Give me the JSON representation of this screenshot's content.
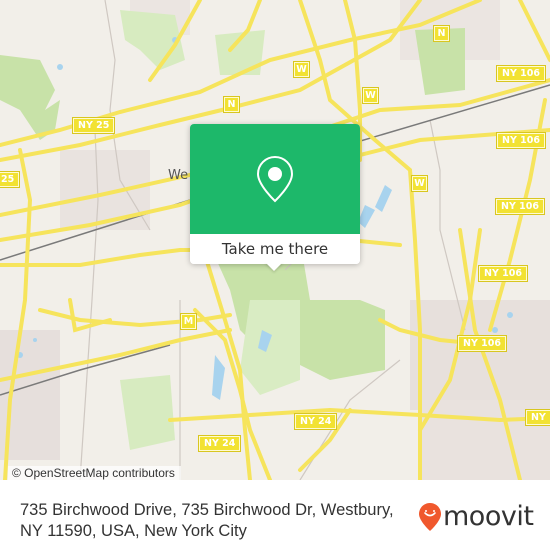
{
  "map": {
    "place_label": "We",
    "road_shields": [
      {
        "label": "NY 25",
        "kind": "wide"
      },
      {
        "label": "25",
        "kind": "wide"
      },
      {
        "label": "N",
        "kind": "square"
      },
      {
        "label": "N",
        "kind": "square"
      },
      {
        "label": "W",
        "kind": "square"
      },
      {
        "label": "W",
        "kind": "square"
      },
      {
        "label": "W",
        "kind": "square"
      },
      {
        "label": "M",
        "kind": "square"
      },
      {
        "label": "NY 106",
        "kind": "wide"
      },
      {
        "label": "NY 106",
        "kind": "wide"
      },
      {
        "label": "NY 106",
        "kind": "wide"
      },
      {
        "label": "NY 106",
        "kind": "wide"
      },
      {
        "label": "NY 106",
        "kind": "wide"
      },
      {
        "label": "NY 24",
        "kind": "wide"
      },
      {
        "label": "NY 24",
        "kind": "wide"
      },
      {
        "label": "NY",
        "kind": "wide"
      }
    ],
    "attribution": "© OpenStreetMap contributors",
    "colors": {
      "land": "#f2efe9",
      "park": "#c8e2a8",
      "water": "#a8d3ee",
      "road": "#f6e45c",
      "rail": "#777777"
    }
  },
  "popup": {
    "icon": "map-pin-icon",
    "button_label": "Take me there",
    "color": "#1db86a"
  },
  "footer": {
    "address": "735 Birchwood Drive, 735 Birchwood Dr, Westbury, NY 11590, USA, New York City",
    "logo_text": "moovit",
    "logo_icon": "moovit-pin-icon",
    "logo_color": "#f0582d"
  }
}
